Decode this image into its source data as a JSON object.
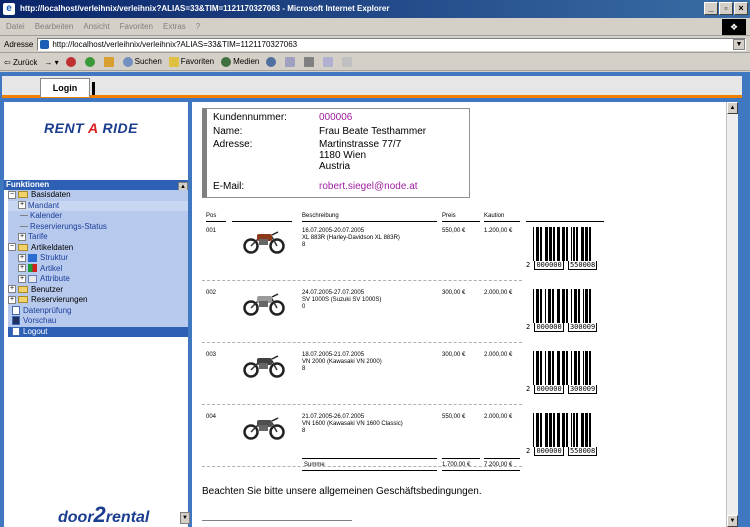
{
  "window": {
    "title": "http://localhost/verleihnix/verleihnix?ALIAS=33&TIM=1121170327063 - Microsoft Internet Explorer",
    "min": "_",
    "max": "▫",
    "close": "×"
  },
  "menu": [
    "Datei",
    "Bearbeiten",
    "Ansicht",
    "Favoriten",
    "Extras",
    "?"
  ],
  "address": {
    "label": "Adresse",
    "url": "http://localhost/verleihnix/verleihnix?ALIAS=33&TIM=1121170327063"
  },
  "toolbar": {
    "back": "Zurück",
    "search": "Suchen",
    "favorites": "Favoriten",
    "media": "Medien"
  },
  "tabs": {
    "login": "Login"
  },
  "logos": {
    "rent_a_ride": "RENT A RIDE",
    "door2rental": "door2rental"
  },
  "nav": {
    "header": "Funktionen",
    "items": [
      {
        "label": "Basisdaten",
        "level": 0,
        "expanded": true
      },
      {
        "label": "Mandant",
        "level": 1
      },
      {
        "label": "Kalender",
        "level": 2
      },
      {
        "label": "Reservierungs-Status",
        "level": 2
      },
      {
        "label": "Tarife",
        "level": 1
      },
      {
        "label": "Artikeldaten",
        "level": 0,
        "expanded": true
      },
      {
        "label": "Struktur",
        "level": 1
      },
      {
        "label": "Artikel",
        "level": 1
      },
      {
        "label": "Attribute",
        "level": 1
      },
      {
        "label": "Benutzer",
        "level": 0
      },
      {
        "label": "Reservierungen",
        "level": 0
      },
      {
        "label": "Datenprüfung",
        "level": 0
      },
      {
        "label": "Vorschau",
        "level": 0
      },
      {
        "label": "Logout",
        "level": 0
      }
    ]
  },
  "customer": {
    "number_label": "Kundennummer:",
    "number": "000006",
    "name_label": "Name:",
    "name": "Frau Beate Testhammer",
    "address_label": "Adresse:",
    "street": "Martinstrasse 77/7",
    "city": "1180 Wien",
    "country": "Austria",
    "email_label": "E-Mail:",
    "email": "robert.siegel@node.at"
  },
  "table": {
    "headers": {
      "pos": "Pos",
      "desc": "Beschreibung",
      "price": "Preis",
      "deposit": "Kaution"
    },
    "rows": [
      {
        "pos": "001",
        "dates": "16.07.2005-20.07.2005",
        "model": "XL 883R (Harley-Davidson XL 883R)",
        "qty": "8",
        "price": "550,00 €",
        "deposit": "1.200,00 €",
        "bc_lead": "2",
        "bc_a": "000000",
        "bc_b": "550008"
      },
      {
        "pos": "002",
        "dates": "24.07.2005-27.07.2005",
        "model": "SV 1000S (Suzuki SV 1000S)",
        "qty": "0",
        "price": "300,00 €",
        "deposit": "2.000,00 €",
        "bc_lead": "2",
        "bc_a": "000000",
        "bc_b": "300009"
      },
      {
        "pos": "003",
        "dates": "18.07.2005-21.07.2005",
        "model": "VN 2000 (Kawasaki VN 2000)",
        "qty": "8",
        "price": "300,00 €",
        "deposit": "2.000,00 €",
        "bc_lead": "2",
        "bc_a": "000000",
        "bc_b": "300009"
      },
      {
        "pos": "004",
        "dates": "21.07.2005-26.07.2005",
        "model": "VN 1600 (Kawasaki VN 1600 Classic)",
        "qty": "8",
        "price": "550,00 €",
        "deposit": "2.000,00 €",
        "bc_lead": "2",
        "bc_a": "000000",
        "bc_b": "550008"
      }
    ],
    "sum_label": "Summe",
    "sum_price": "1.700,00 €",
    "sum_deposit": "7.200,00 €"
  },
  "notice": "Beachten Sie bitte unsere allgemeinen Geschäftsbedingungen."
}
